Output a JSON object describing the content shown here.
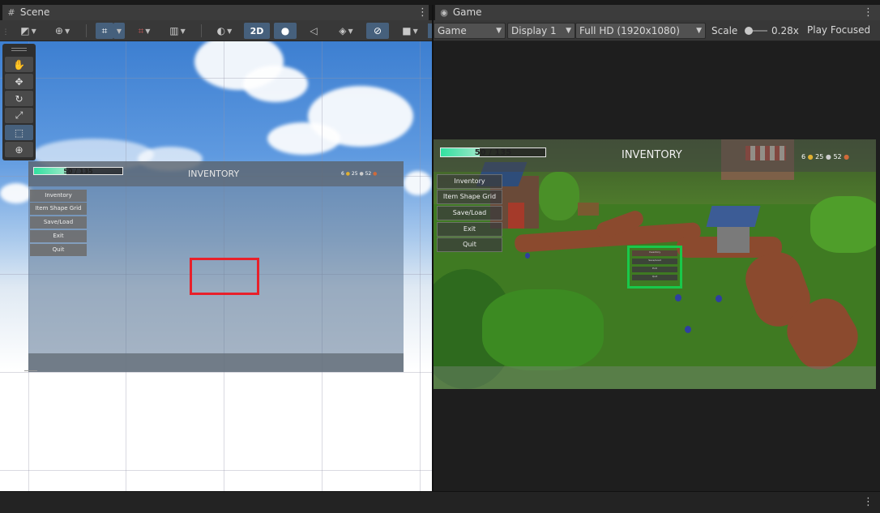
{
  "scene_tab": {
    "title": "Scene"
  },
  "game_tab": {
    "title": "Game"
  },
  "scene_toolbar": {
    "mode_2d": "2D"
  },
  "game_toolbar": {
    "view": "Game",
    "display": "Display 1",
    "resolution": "Full HD (1920x1080)",
    "scale_label": "Scale",
    "scale_value": "0.28x",
    "play_mode": "Play Focused",
    "scale_fraction": 0.1
  },
  "hud": {
    "health": "50 / 135",
    "health_fraction": 0.37,
    "title": "INVENTORY",
    "counter_1": "6",
    "counter_2": "25",
    "counter_3": "52"
  },
  "menu": {
    "items": [
      "Inventory",
      "Item Shape Grid",
      "Save/Load",
      "Exit",
      "Quit"
    ]
  },
  "colors": {
    "selection_red": "#e8202a",
    "selection_green": "#19c84a",
    "active_blue": "#46607c"
  }
}
